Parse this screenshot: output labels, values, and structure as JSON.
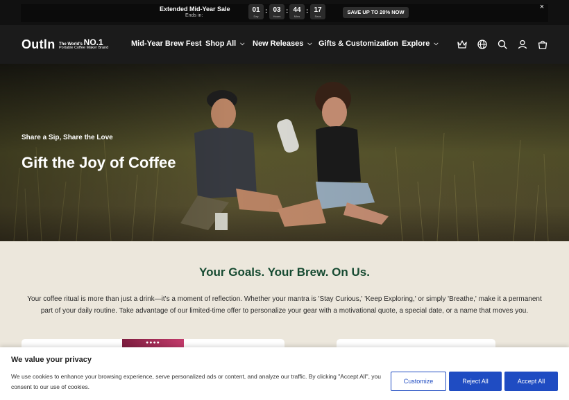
{
  "announcement": {
    "sale_title": "Extended Mid-Year Sale",
    "ends_in": "Ends in:",
    "countdown": [
      {
        "value": "01",
        "label": "Day"
      },
      {
        "value": "03",
        "label": "Hours"
      },
      {
        "value": "44",
        "label": "Mins"
      },
      {
        "value": "17",
        "label": "Secs"
      }
    ],
    "separator": ":",
    "cta": "SAVE UP TO 20% NOW",
    "close": "×"
  },
  "header": {
    "logo_word": "Outln",
    "logo_tag_prefix": "The World's",
    "logo_tag_rank": "NO.1",
    "logo_tag_sub": "Portable Coffee Maker Brand",
    "nav": [
      {
        "label": "Mid-Year Brew Fest"
      },
      {
        "label": "Shop All"
      },
      {
        "label": "New Releases"
      },
      {
        "label": "Gifts & Customization"
      },
      {
        "label": "Explore"
      }
    ],
    "icons": [
      "crown-icon",
      "globe-icon",
      "search-icon",
      "account-icon",
      "cart-icon"
    ]
  },
  "hero": {
    "eyebrow": "Share a Sip, Share the Love",
    "title": "Gift the Joy of Coffee"
  },
  "section": {
    "title": "Your Goals. Your Brew. On Us.",
    "body": "Your coffee ritual is more than just a drink—it's a moment of reflection. Whether your mantra is 'Stay Curious,' 'Keep Exploring,' or simply 'Breathe,' make it a permanent part of your daily routine. Take advantage of our limited-time offer to personalize your gear with a motivational quote, a special date, or a name that moves you."
  },
  "cookie": {
    "title": "We value your privacy",
    "text": "We use cookies to enhance your browsing experience, serve personalized ads or content, and analyze our traffic. By clicking \"Accept All\", you consent to our use of cookies.",
    "customize": "Customize",
    "reject": "Reject All",
    "accept": "Accept All"
  },
  "colors": {
    "accent_blue": "#1f4cc2",
    "section_title_green": "#164a31",
    "header_bg": "#1b1b1b",
    "section_bg": "#ece7dc"
  }
}
